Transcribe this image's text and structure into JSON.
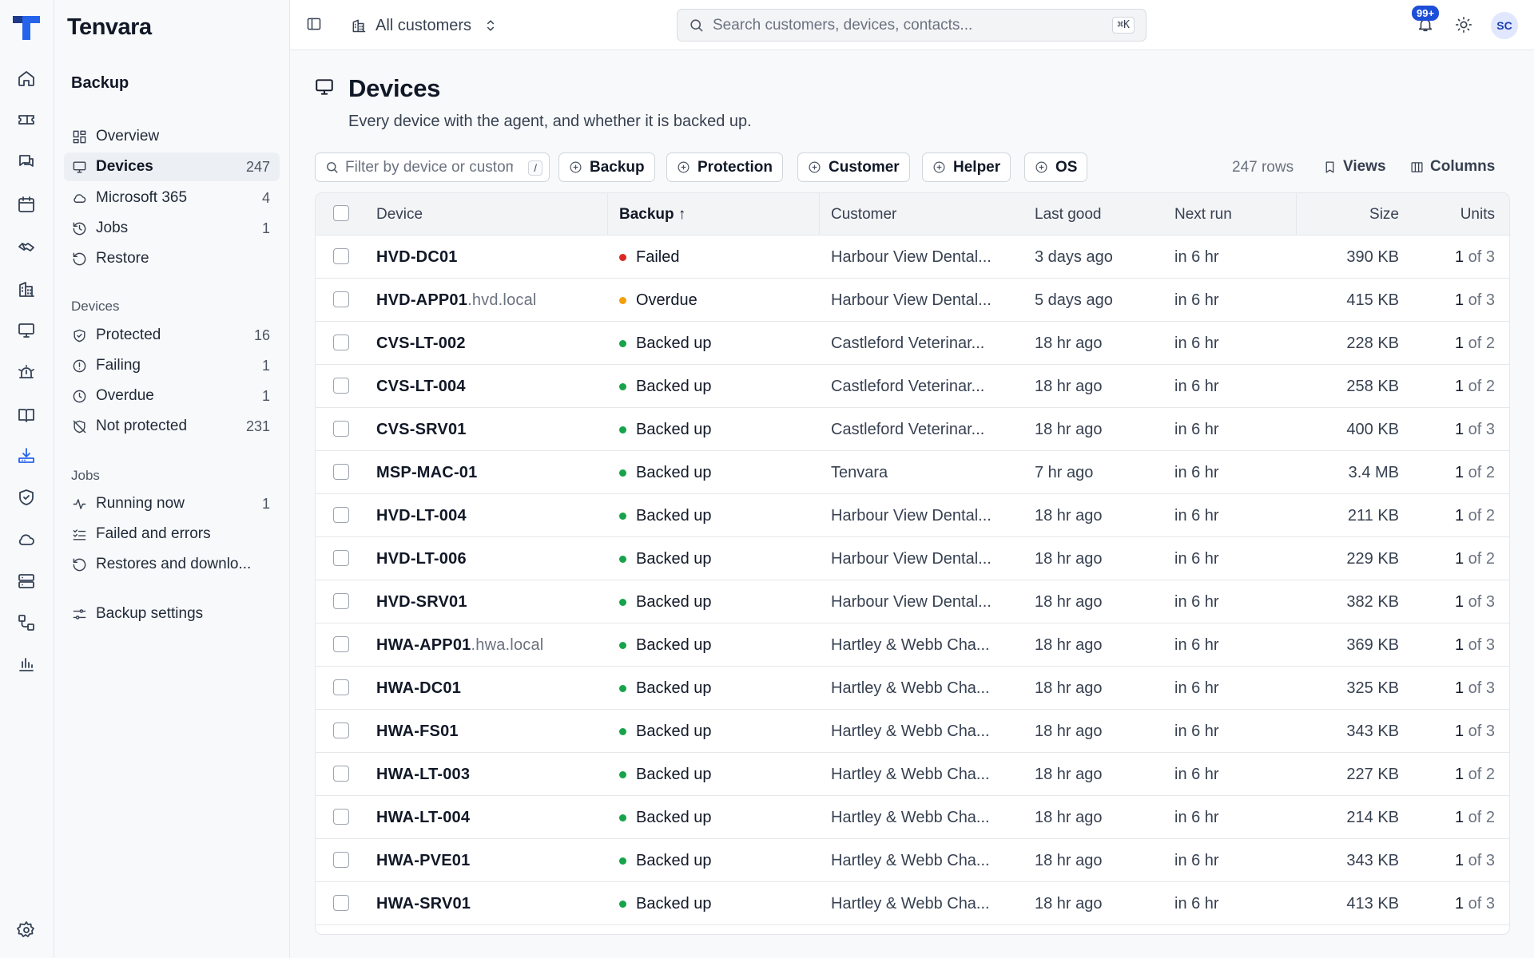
{
  "app": {
    "brand": "Tenvara"
  },
  "rail": {
    "icons": [
      "home-icon",
      "ticket-icon",
      "chat-icon",
      "calendar-icon",
      "handshake-icon",
      "building-icon",
      "monitor-icon",
      "alarm-icon",
      "book-icon",
      "download-tray-icon",
      "shield-icon",
      "cloud-icon",
      "server-icon",
      "workflow-icon",
      "bar-chart-icon",
      "settings-icon"
    ],
    "active": "download-tray-icon"
  },
  "sidebar": {
    "section_title": "Backup",
    "items": [
      {
        "label": "Overview",
        "icon": "grid-icon",
        "count": ""
      },
      {
        "label": "Devices",
        "icon": "monitor-icon",
        "count": "247",
        "active": true
      },
      {
        "label": "Microsoft 365",
        "icon": "cloud-icon",
        "count": "4"
      },
      {
        "label": "Jobs",
        "icon": "history-icon",
        "count": "1"
      },
      {
        "label": "Restore",
        "icon": "rotate-ccw-icon",
        "count": ""
      }
    ],
    "devices_heading": "Devices",
    "device_items": [
      {
        "label": "Protected",
        "icon": "shield-check-icon",
        "count": "16"
      },
      {
        "label": "Failing",
        "icon": "alert-circle-icon",
        "count": "1"
      },
      {
        "label": "Overdue",
        "icon": "clock-icon",
        "count": "1"
      },
      {
        "label": "Not protected",
        "icon": "shield-off-icon",
        "count": "231"
      }
    ],
    "jobs_heading": "Jobs",
    "job_items": [
      {
        "label": "Running now",
        "icon": "activity-icon",
        "count": "1"
      },
      {
        "label": "Failed and errors",
        "icon": "list-checks-icon",
        "count": ""
      },
      {
        "label": "Restores and downlo...",
        "icon": "rotate-ccw-icon",
        "count": ""
      }
    ],
    "settings_label": "Backup settings"
  },
  "topbar": {
    "customer_switch": "All customers",
    "search_placeholder": "Search customers, devices, contacts...",
    "search_shortcut": "⌘K",
    "notifications_badge": "99+",
    "avatar_initials": "SC"
  },
  "page": {
    "title": "Devices",
    "subtitle": "Every device with the agent, and whether it is backed up."
  },
  "toolbar": {
    "filter_placeholder": "Filter by device or customer",
    "filter_shortcut": "/",
    "chips": [
      "Backup",
      "Protection",
      "Customer",
      "Helper",
      "OS"
    ],
    "rows_count": "247 rows",
    "views_label": "Views",
    "columns_label": "Columns"
  },
  "table": {
    "columns": {
      "device": "Device",
      "backup": "Backup",
      "customer": "Customer",
      "last_good": "Last good",
      "next_run": "Next run",
      "size": "Size",
      "units": "Units"
    },
    "sort_indicator": "↑",
    "status_colors": {
      "Failed": "#dc2626",
      "Overdue": "#f59e0b",
      "Backed up": "#16a34a"
    },
    "rows": [
      {
        "device": "HVD-DC01",
        "domain": "",
        "status": "Failed",
        "customer": "Harbour View Dental...",
        "last_good": "3 days ago",
        "next_run": "in 6 hr",
        "size": "390 KB",
        "units_used": "1",
        "units_total": "of 3"
      },
      {
        "device": "HVD-APP01",
        "domain": ".hvd.local",
        "status": "Overdue",
        "customer": "Harbour View Dental...",
        "last_good": "5 days ago",
        "next_run": "in 6 hr",
        "size": "415 KB",
        "units_used": "1",
        "units_total": "of 3"
      },
      {
        "device": "CVS-LT-002",
        "domain": "",
        "status": "Backed up",
        "customer": "Castleford Veterinar...",
        "last_good": "18 hr ago",
        "next_run": "in 6 hr",
        "size": "228 KB",
        "units_used": "1",
        "units_total": "of 2"
      },
      {
        "device": "CVS-LT-004",
        "domain": "",
        "status": "Backed up",
        "customer": "Castleford Veterinar...",
        "last_good": "18 hr ago",
        "next_run": "in 6 hr",
        "size": "258 KB",
        "units_used": "1",
        "units_total": "of 2"
      },
      {
        "device": "CVS-SRV01",
        "domain": "",
        "status": "Backed up",
        "customer": "Castleford Veterinar...",
        "last_good": "18 hr ago",
        "next_run": "in 6 hr",
        "size": "400 KB",
        "units_used": "1",
        "units_total": "of 3"
      },
      {
        "device": "MSP-MAC-01",
        "domain": "",
        "status": "Backed up",
        "customer": "Tenvara",
        "last_good": "7 hr ago",
        "next_run": "in 6 hr",
        "size": "3.4 MB",
        "units_used": "1",
        "units_total": "of 2"
      },
      {
        "device": "HVD-LT-004",
        "domain": "",
        "status": "Backed up",
        "customer": "Harbour View Dental...",
        "last_good": "18 hr ago",
        "next_run": "in 6 hr",
        "size": "211 KB",
        "units_used": "1",
        "units_total": "of 2"
      },
      {
        "device": "HVD-LT-006",
        "domain": "",
        "status": "Backed up",
        "customer": "Harbour View Dental...",
        "last_good": "18 hr ago",
        "next_run": "in 6 hr",
        "size": "229 KB",
        "units_used": "1",
        "units_total": "of 2"
      },
      {
        "device": "HVD-SRV01",
        "domain": "",
        "status": "Backed up",
        "customer": "Harbour View Dental...",
        "last_good": "18 hr ago",
        "next_run": "in 6 hr",
        "size": "382 KB",
        "units_used": "1",
        "units_total": "of 3"
      },
      {
        "device": "HWA-APP01",
        "domain": ".hwa.local",
        "status": "Backed up",
        "customer": "Hartley & Webb Cha...",
        "last_good": "18 hr ago",
        "next_run": "in 6 hr",
        "size": "369 KB",
        "units_used": "1",
        "units_total": "of 3"
      },
      {
        "device": "HWA-DC01",
        "domain": "",
        "status": "Backed up",
        "customer": "Hartley & Webb Cha...",
        "last_good": "18 hr ago",
        "next_run": "in 6 hr",
        "size": "325 KB",
        "units_used": "1",
        "units_total": "of 3"
      },
      {
        "device": "HWA-FS01",
        "domain": "",
        "status": "Backed up",
        "customer": "Hartley & Webb Cha...",
        "last_good": "18 hr ago",
        "next_run": "in 6 hr",
        "size": "343 KB",
        "units_used": "1",
        "units_total": "of 3"
      },
      {
        "device": "HWA-LT-003",
        "domain": "",
        "status": "Backed up",
        "customer": "Hartley & Webb Cha...",
        "last_good": "18 hr ago",
        "next_run": "in 6 hr",
        "size": "227 KB",
        "units_used": "1",
        "units_total": "of 2"
      },
      {
        "device": "HWA-LT-004",
        "domain": "",
        "status": "Backed up",
        "customer": "Hartley & Webb Cha...",
        "last_good": "18 hr ago",
        "next_run": "in 6 hr",
        "size": "214 KB",
        "units_used": "1",
        "units_total": "of 2"
      },
      {
        "device": "HWA-PVE01",
        "domain": "",
        "status": "Backed up",
        "customer": "Hartley & Webb Cha...",
        "last_good": "18 hr ago",
        "next_run": "in 6 hr",
        "size": "343 KB",
        "units_used": "1",
        "units_total": "of 3"
      },
      {
        "device": "HWA-SRV01",
        "domain": "",
        "status": "Backed up",
        "customer": "Hartley & Webb Cha...",
        "last_good": "18 hr ago",
        "next_run": "in 6 hr",
        "size": "413 KB",
        "units_used": "1",
        "units_total": "of 3"
      }
    ]
  }
}
